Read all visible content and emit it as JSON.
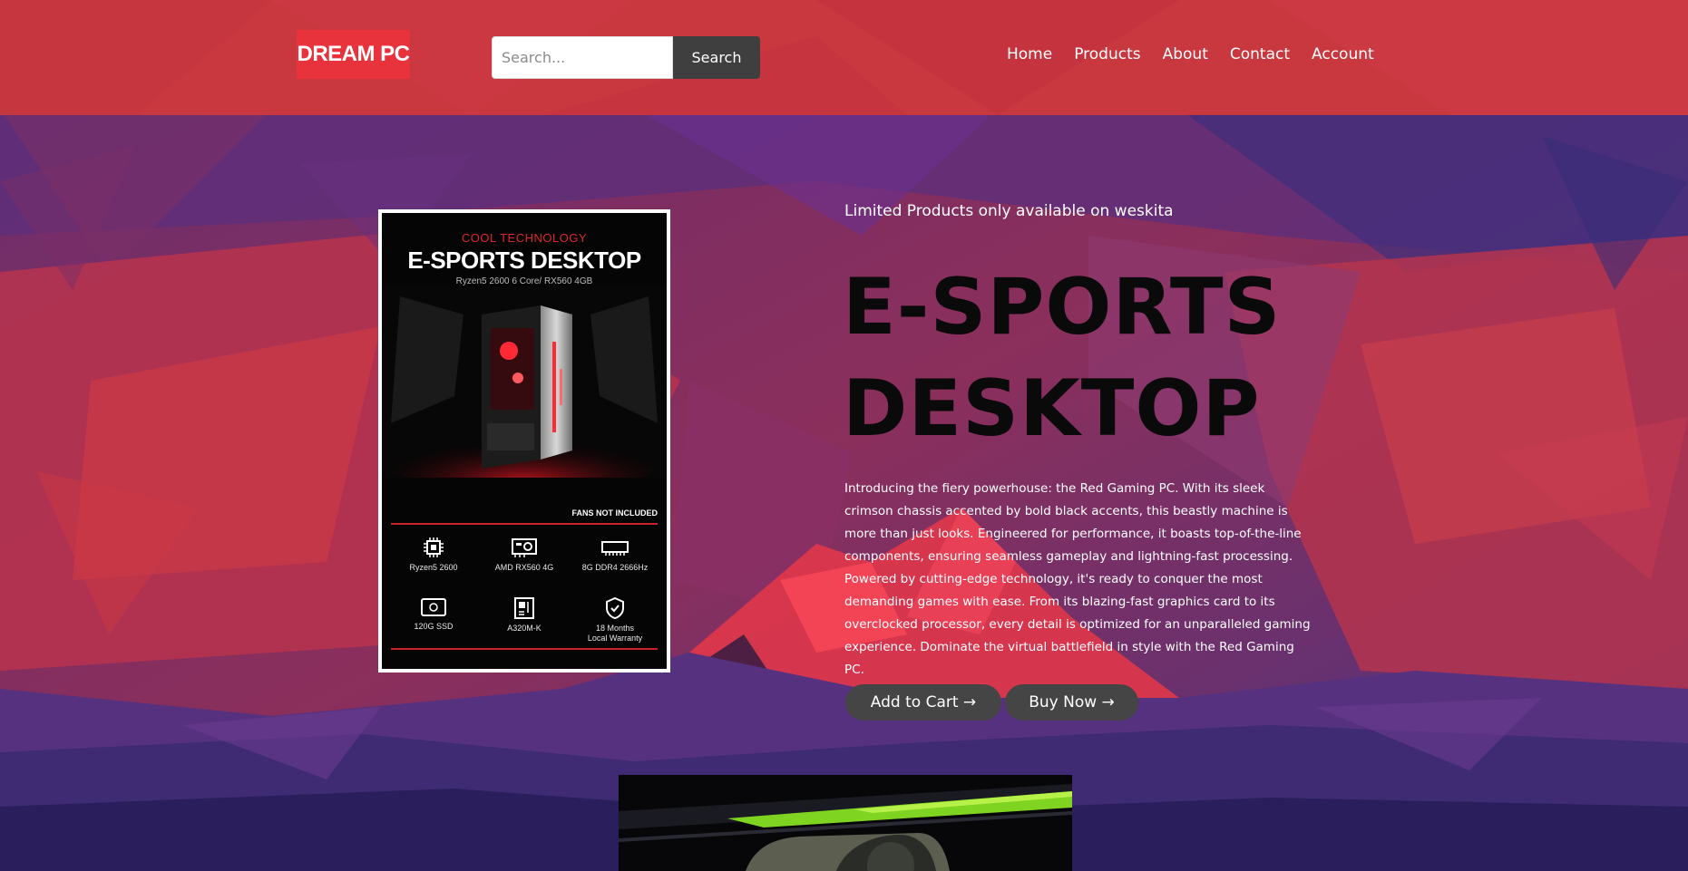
{
  "brand": {
    "logo_text": "DREAM PC"
  },
  "search": {
    "placeholder": "Search...",
    "value": "",
    "button_label": "Search"
  },
  "nav": {
    "items": [
      {
        "label": "Home"
      },
      {
        "label": "Products"
      },
      {
        "label": "About"
      },
      {
        "label": "Contact"
      },
      {
        "label": "Account"
      }
    ]
  },
  "product_image": {
    "tagline": "COOL TECHNOLOGY",
    "title": "E-SPORTS DESKTOP",
    "specs": "Ryzen5 2600 6 Core/ RX560 4GB",
    "note": "FANS NOT INCLUDED",
    "features": [
      {
        "icon": "cpu-icon",
        "label": "Ryzen5 2600"
      },
      {
        "icon": "gpu-icon",
        "label": "AMD RX560 4G"
      },
      {
        "icon": "ram-icon",
        "label": "8G DDR4 2666Hz"
      },
      {
        "icon": "ssd-icon",
        "label": "120G SSD"
      },
      {
        "icon": "motherboard-icon",
        "label": "A320M-K"
      },
      {
        "icon": "shield-check-icon",
        "label": "18 Months\nLocal Warranty"
      }
    ]
  },
  "hero": {
    "eyebrow": "Limited Products only available on weskita",
    "title": "E-SPORTS DESKTOP",
    "description": "Introducing the fiery powerhouse: the Red Gaming PC. With its sleek crimson chassis accented by bold black accents, this beastly machine is more than just looks. Engineered for performance, it boasts top-of-the-line components, ensuring seamless gameplay and lightning-fast processing. Powered by cutting-edge technology, it's ready to conquer the most demanding games with ease. From its blazing-fast graphics card to its overclocked processor, every detail is optimized for an unparalleled gaming experience. Dominate the virtual battlefield in style with the Red Gaming PC.",
    "add_to_cart_label": "Add to Cart →",
    "buy_now_label": "Buy Now →"
  },
  "colors": {
    "header_red": "#c9373f",
    "logo_red": "#e8323c",
    "button_dark": "#454545",
    "bg_purple": "#4a2f7a",
    "bg_red": "#c8334a"
  }
}
